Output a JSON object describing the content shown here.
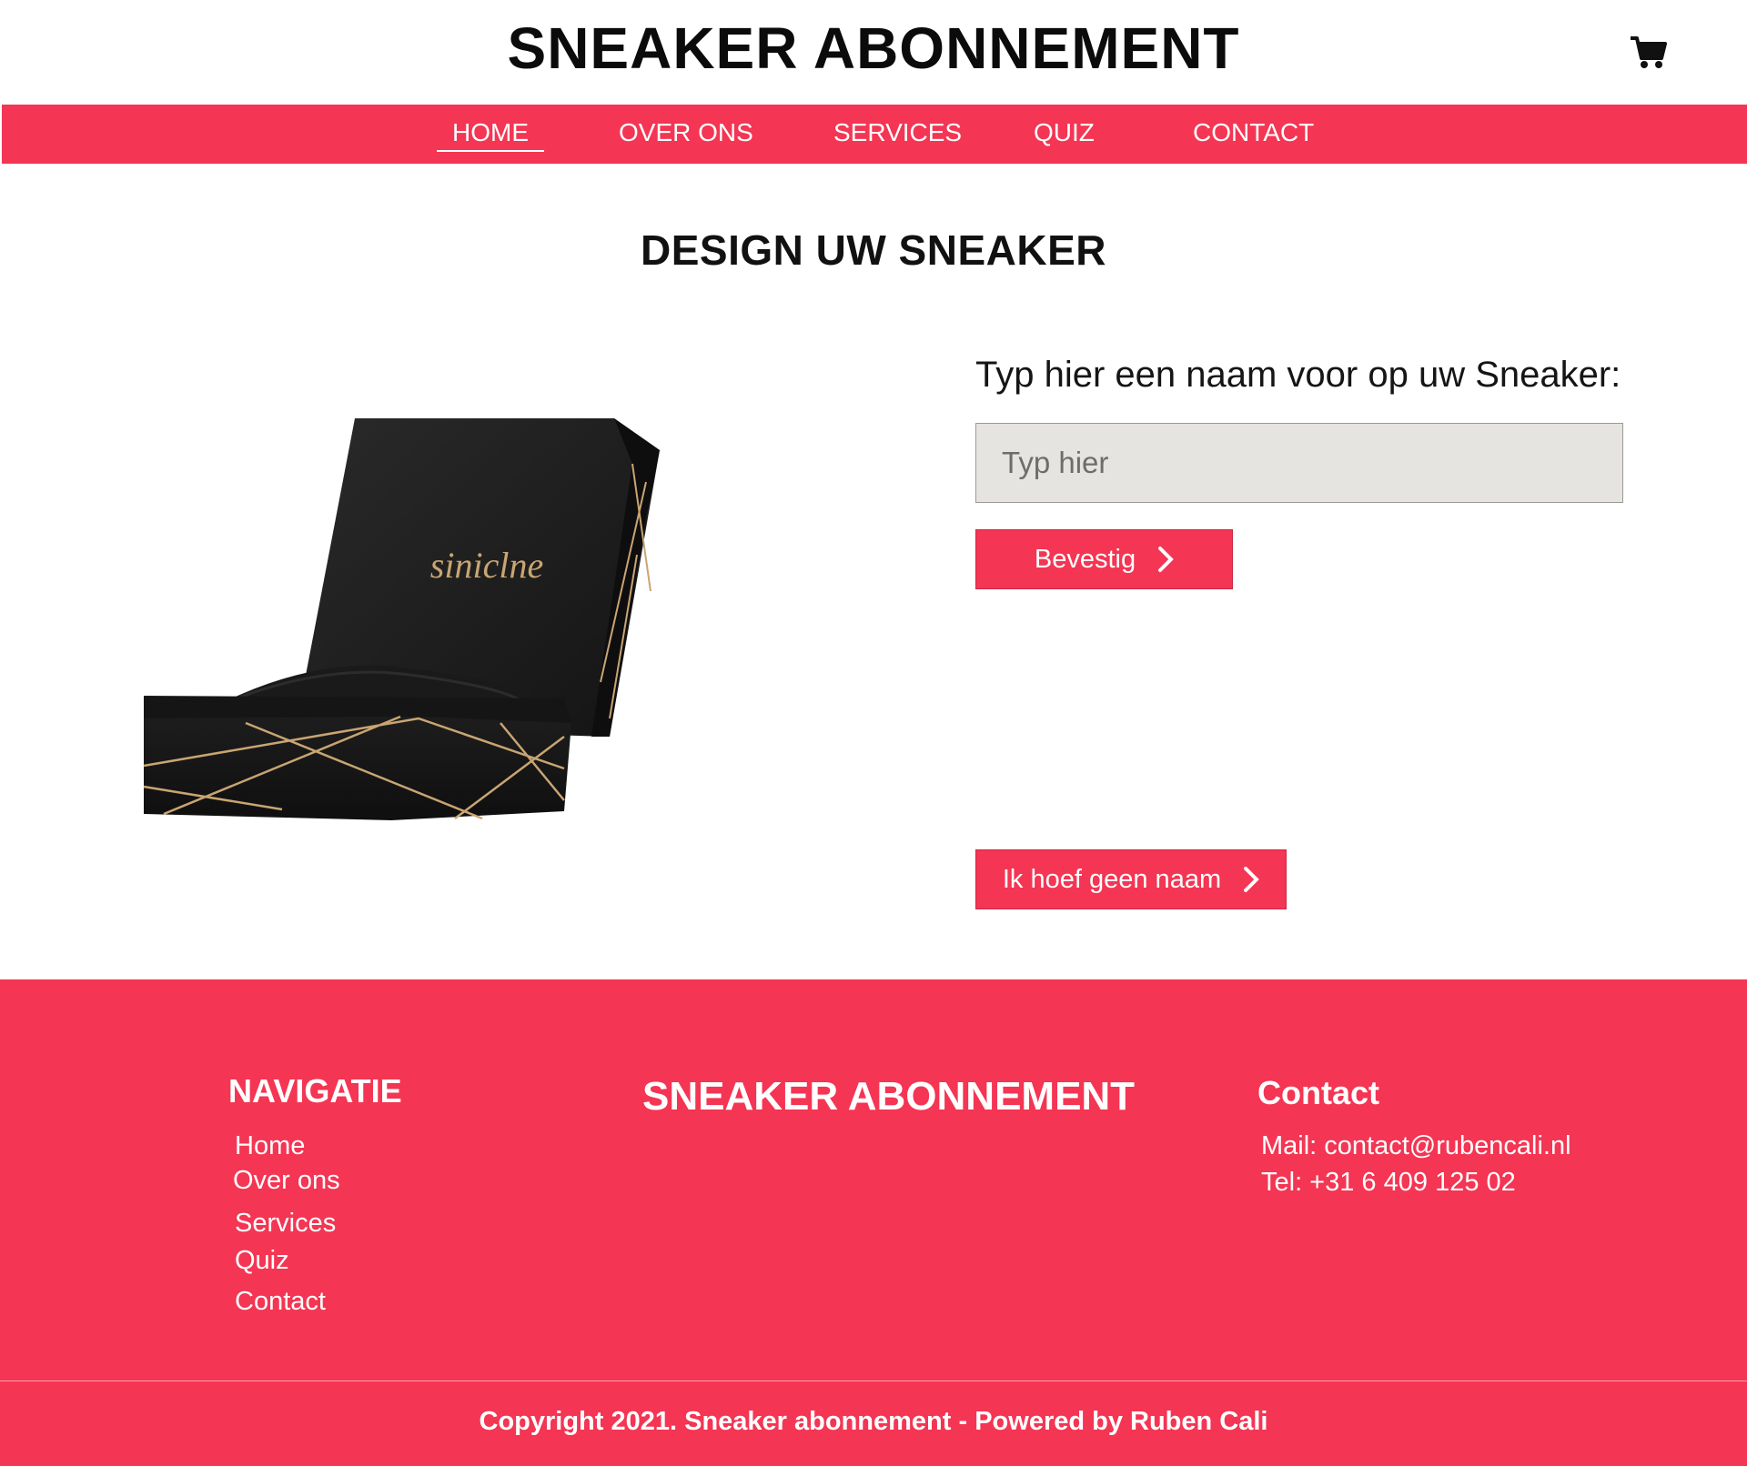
{
  "header": {
    "title": "SNEAKER ABONNEMENT",
    "cart_icon": "shopping-cart-icon"
  },
  "nav": {
    "items": [
      {
        "label": "HOME",
        "active": true
      },
      {
        "label": "OVER ONS",
        "active": false
      },
      {
        "label": "SERVICES",
        "active": false
      },
      {
        "label": "QUIZ",
        "active": false
      },
      {
        "label": "CONTACT",
        "active": false
      }
    ]
  },
  "main": {
    "heading": "DESIGN UW SNEAKER",
    "box_brand_text": "siniclne",
    "name_label": "Typ hier een naam voor op uw Sneaker:",
    "name_input": {
      "value": "",
      "placeholder": "Typ hier"
    },
    "confirm_button": "Bevestig",
    "no_name_button": "Ik hoef geen naam"
  },
  "footer": {
    "nav_heading": "NAVIGATIE",
    "nav_links": [
      "Home",
      "Over ons",
      "Services",
      "Quiz",
      "Contact"
    ],
    "brand": "SNEAKER ABONNEMENT",
    "contact_heading": "Contact",
    "mail": "Mail: contact@rubencali.nl",
    "tel": "Tel: +31 6 409 125 02",
    "copyright": "Copyright 2021. Sneaker abonnement - Powered by Ruben Cali"
  },
  "colors": {
    "accent": "#f43553",
    "input_bg": "#e6e4e0",
    "text": "#111111"
  }
}
